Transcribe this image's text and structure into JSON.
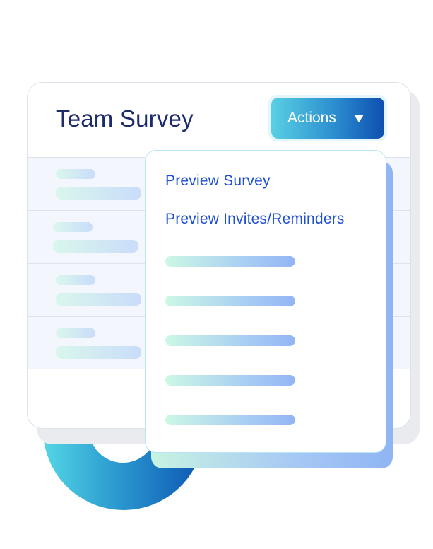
{
  "card": {
    "title": "Team Survey",
    "actions_label": "Actions",
    "actions_icon": "caret-down-icon"
  },
  "table": {
    "row_count": 4
  },
  "menu": {
    "items": [
      {
        "label": "Preview Survey"
      },
      {
        "label": "Preview Invites/Reminders"
      }
    ],
    "placeholder_item_count": 5
  },
  "colors": {
    "title": "#1d2b6b",
    "menu_link": "#1d4fd6",
    "accent_start": "#59d0e3",
    "accent_end": "#0d4fb0"
  }
}
